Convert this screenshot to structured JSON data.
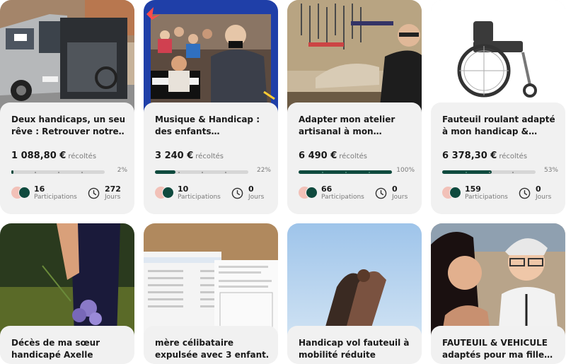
{
  "cards": [
    {
      "title_line1": "Deux handicaps, un seul",
      "title_line2": "rêve : Retrouver notre…",
      "amount": "1 088,80 €",
      "amount_label": "récoltés",
      "percent": "2%",
      "progress": 0.02,
      "participations": "16",
      "participations_label": "Participations",
      "days": "272",
      "days_label": "Jours"
    },
    {
      "title_line1": "Musique & Handicap :",
      "title_line2": "des enfants…",
      "amount": "3 240 €",
      "amount_label": "récoltés",
      "percent": "22%",
      "progress": 0.22,
      "participations": "10",
      "participations_label": "Participations",
      "days": "0",
      "days_label": "Jours"
    },
    {
      "title_line1": "Adapter mon atelier",
      "title_line2": "artisanal à mon…",
      "amount": "6 490 €",
      "amount_label": "récoltés",
      "percent": "100%",
      "progress": 1.0,
      "participations": "66",
      "participations_label": "Participations",
      "days": "0",
      "days_label": "Jours"
    },
    {
      "title_line1": "Fauteuil roulant adapté",
      "title_line2": "à mon handicap &…",
      "amount": "6 378,30 €",
      "amount_label": "récoltés",
      "percent": "53%",
      "progress": 0.53,
      "participations": "159",
      "participations_label": "Participations",
      "days": "0",
      "days_label": "Jours"
    },
    {
      "title_line1": "Décès de ma sœur",
      "title_line2": "handicapé Axelle"
    },
    {
      "title_line1": "mère célibataire",
      "title_line2": "expulsée avec 3 enfant…"
    },
    {
      "title_line1": "Handicap vol fauteuil à",
      "title_line2": "mobilité réduite"
    },
    {
      "title_line1": "FAUTEUIL & VEHICULE",
      "title_line2": "adaptés pour ma fille…"
    }
  ],
  "colors": {
    "progress_fill": "#0f4a3e",
    "progress_track": "#d6d6d6",
    "card_bg": "#f1f1f1",
    "avatar_green": "#0f4a3e",
    "avatar_pink": "#f2c1b8"
  }
}
